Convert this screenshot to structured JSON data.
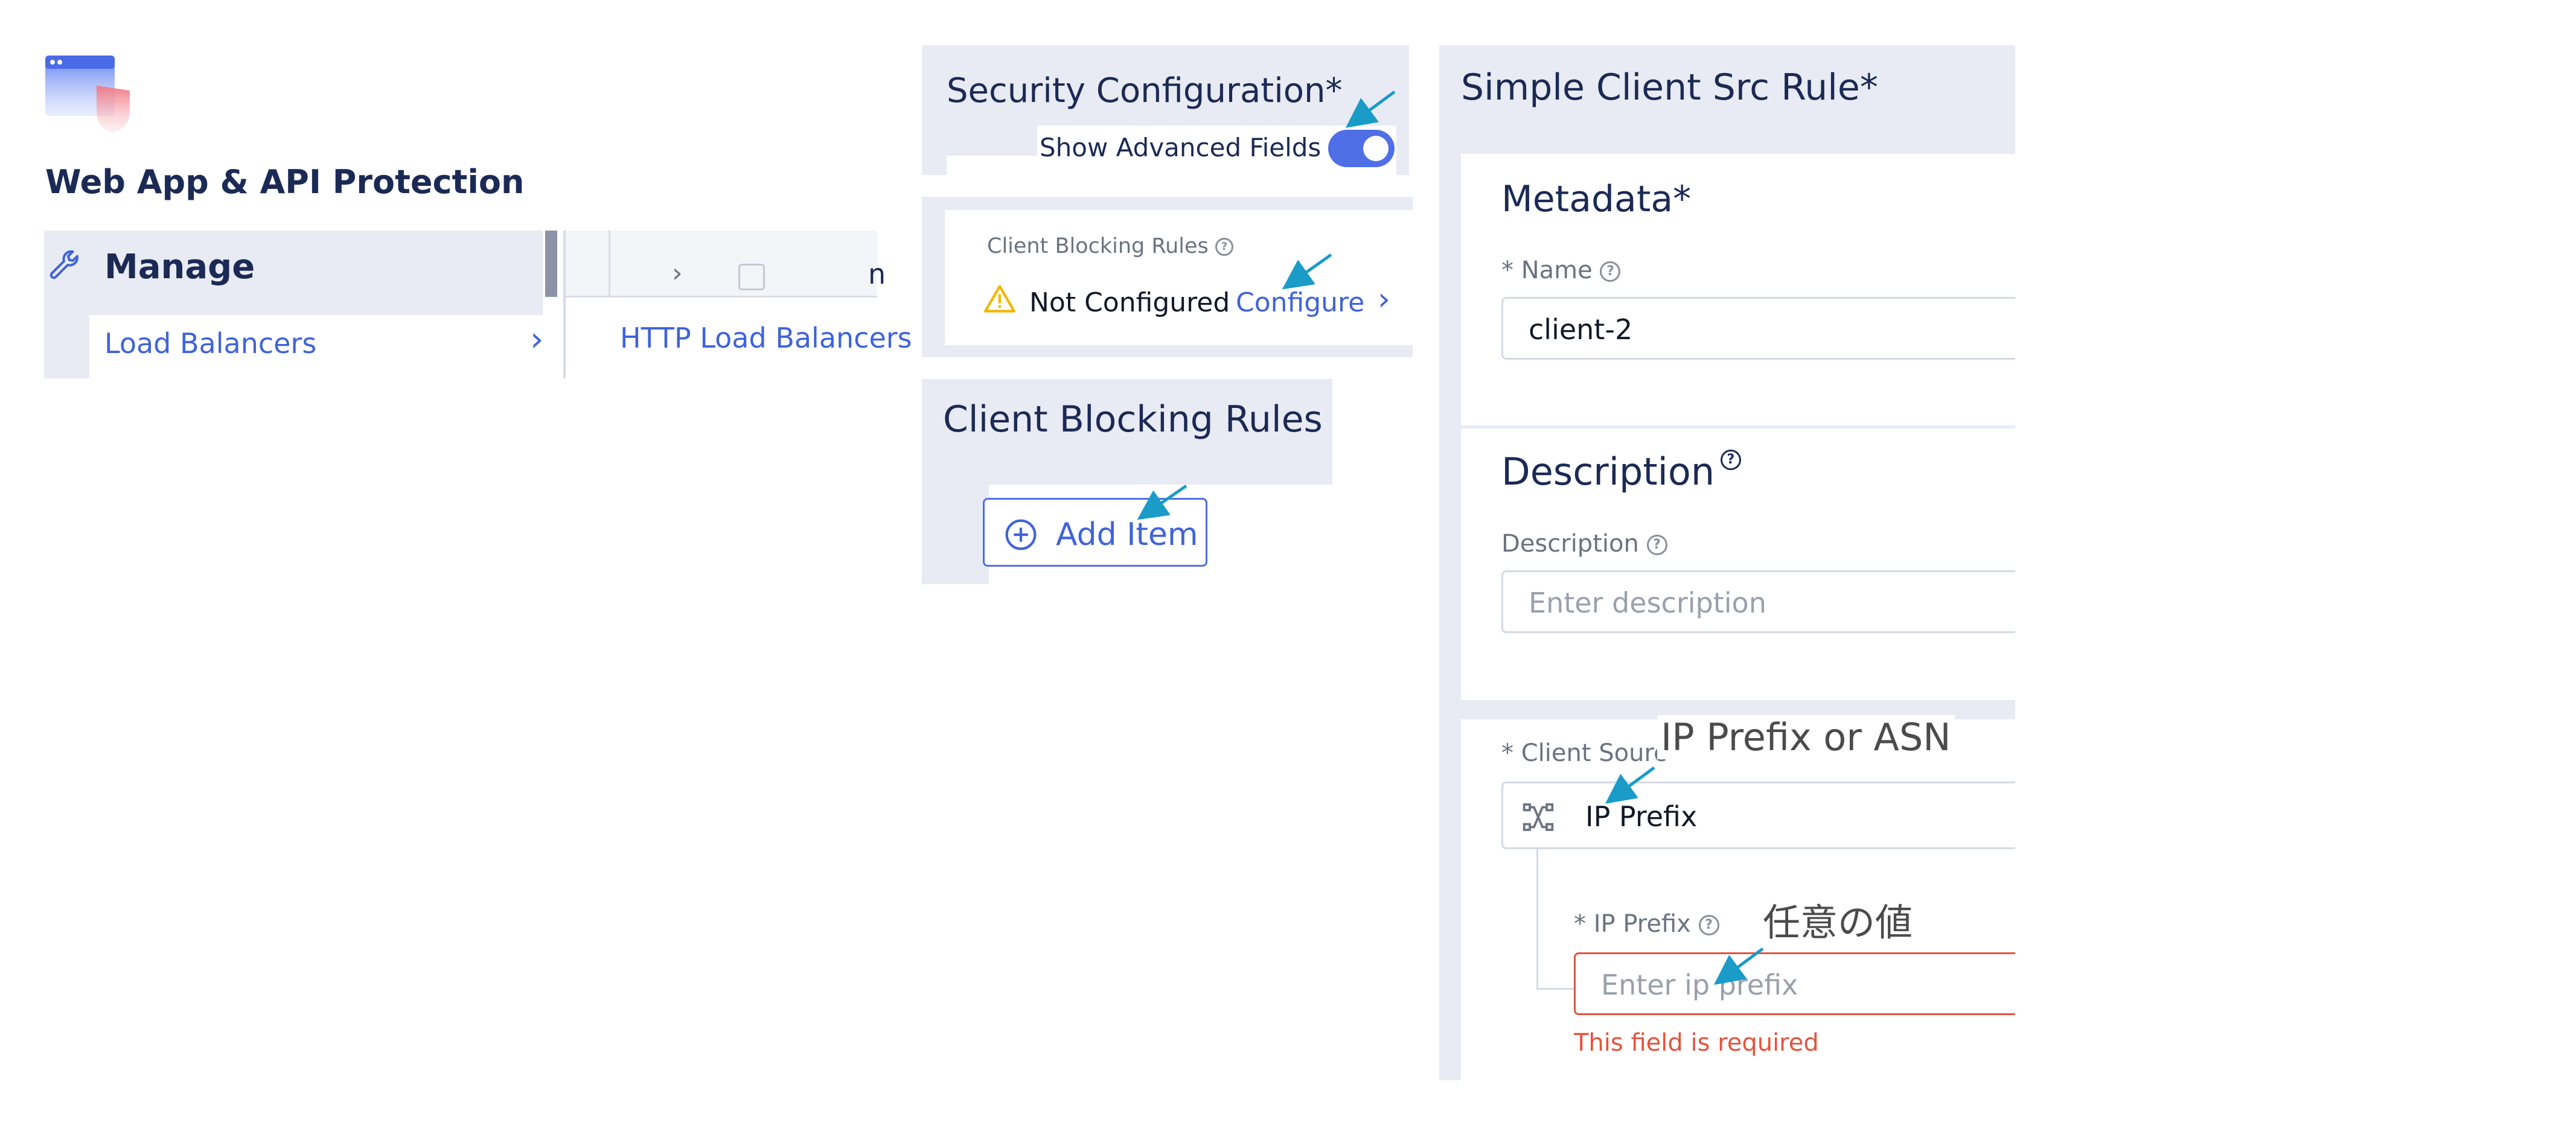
{
  "app": {
    "title": "Web App & API Protection",
    "logo_icon": "browser-shield-icon"
  },
  "sidebar": {
    "manage_label": "Manage",
    "manage_icon": "wrench-icon",
    "load_balancers_label": "Load Balancers",
    "submenu_item": "HTTP Load Balancers",
    "clipped_column_text": "n"
  },
  "security_config": {
    "title": "Security Configuration",
    "required_mark": "*",
    "advanced_toggle_label": "Show Advanced Fields",
    "advanced_toggle_on": true
  },
  "client_blocking_summary": {
    "label": "Client Blocking Rules",
    "status": "Not Configured",
    "configure_link": "Configure"
  },
  "client_blocking_rules": {
    "title": "Client Blocking Rules",
    "add_item_label": "Add Item"
  },
  "rule_form": {
    "title": "Simple Client Src Rule",
    "required_mark": "*",
    "metadata_title": "Metadata",
    "name_label": "Name",
    "name_value": "client-2",
    "description_section_title": "Description",
    "description_label": "Description",
    "description_placeholder": "Enter description",
    "client_source_label": "Client Sourc",
    "client_source_value": "IP Prefix",
    "ip_prefix_label": "IP Prefix",
    "ip_prefix_placeholder": "Enter ip prefix",
    "ip_prefix_error": "This field is required"
  },
  "annotations": {
    "client_source_note": "IP Prefix or ASN",
    "ip_prefix_note": "任意の値"
  },
  "colors": {
    "accent_blue": "#3f63d9",
    "navy_text": "#1b2a55",
    "panel_bg": "#e8ebf3",
    "error_red": "#e5533d",
    "warning_yellow": "#f2b705",
    "annotation_arrow": "#1a9bc8"
  }
}
